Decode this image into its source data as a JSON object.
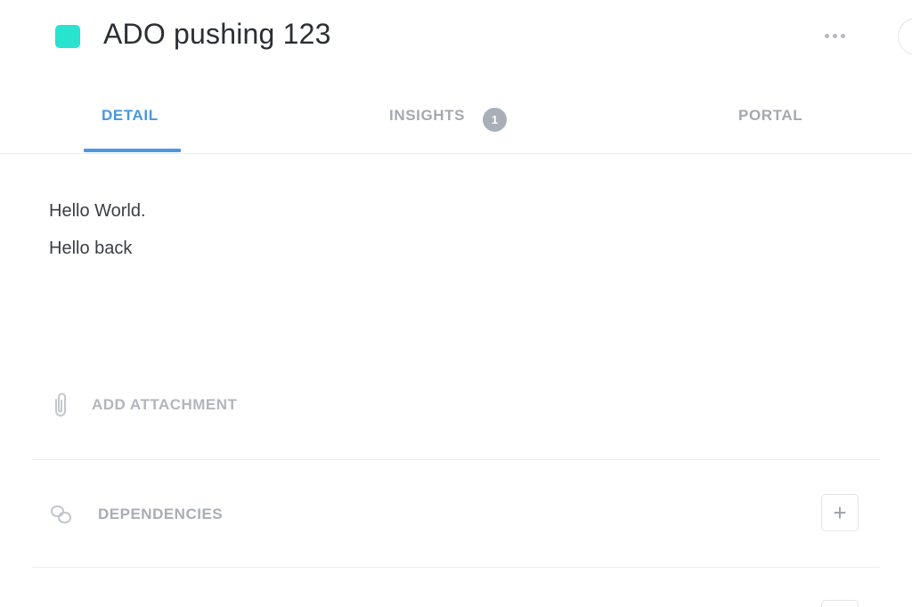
{
  "header": {
    "title": "ADO pushing 123",
    "color_swatch": "#27e3cf",
    "more_icon": "more-horizontal-icon"
  },
  "tabs": [
    {
      "label": "DETAIL",
      "active": true
    },
    {
      "label": "INSIGHTS",
      "badge": "1",
      "active": false
    },
    {
      "label": "PORTAL",
      "active": false
    }
  ],
  "accent_color": "#4a98dd",
  "body": {
    "lines": [
      "Hello World.",
      "Hello back"
    ]
  },
  "attachment": {
    "label": "ADD ATTACHMENT",
    "icon": "paperclip-icon"
  },
  "dependencies": {
    "label": "DEPENDENCIES",
    "icon": "link-icon",
    "add_label": "+"
  }
}
